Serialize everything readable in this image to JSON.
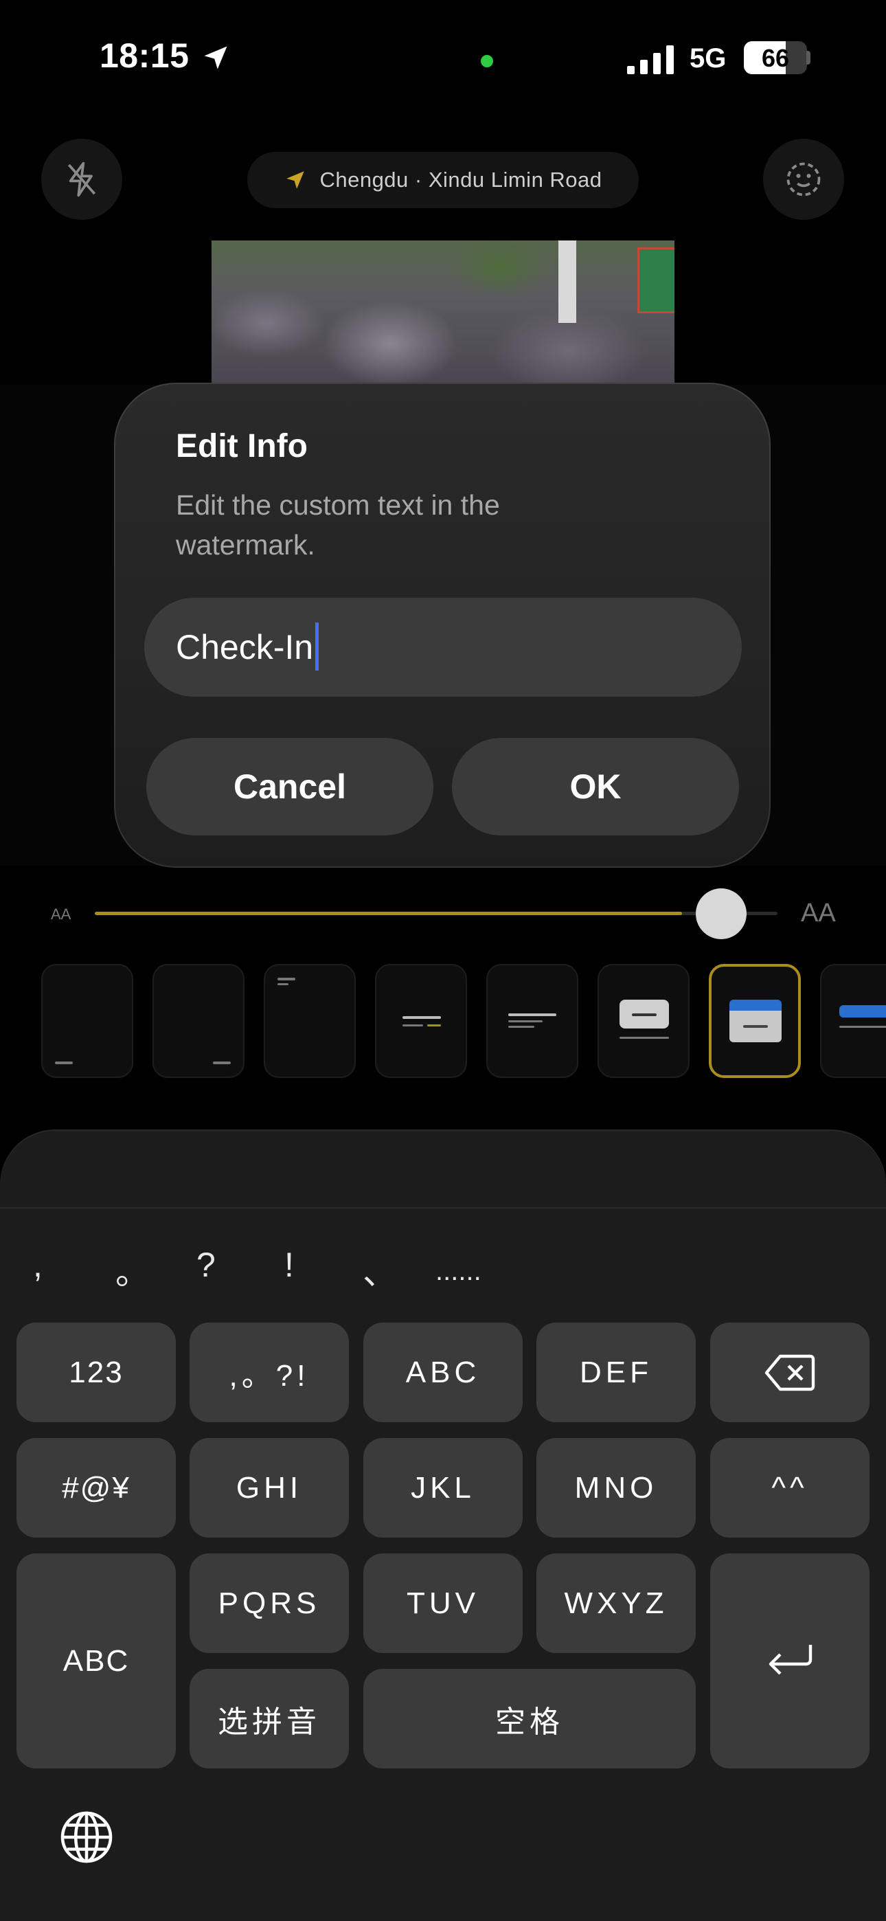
{
  "status_bar": {
    "time": "18:15",
    "network": "5G",
    "battery_percent": "66",
    "battery_level": 0.66
  },
  "camera": {
    "location_label": "Chengdu · Xindu Limin Road"
  },
  "dialog": {
    "title": "Edit Info",
    "subtitle": "Edit the custom text in the watermark.",
    "input_value": "Check-In",
    "cancel_label": "Cancel",
    "ok_label": "OK"
  },
  "text_size_slider": {
    "min_label": "AA",
    "max_label": "AA",
    "level": 0.86,
    "accent_color": "#a98d1f"
  },
  "templates": {
    "count": 8,
    "selected_index": 6
  },
  "keyboard": {
    "punctuation": [
      ",",
      "。",
      "?",
      "!",
      "、",
      "......"
    ],
    "keys": {
      "k123": "123",
      "punct_key": ",。?!",
      "abc": "ABC",
      "def": "DEF",
      "symbols": "#@¥",
      "ghi": "GHI",
      "jkl": "JKL",
      "mno": "MNO",
      "emoticon": "^^",
      "abc_mode": "ABC",
      "pqrs": "PQRS",
      "tuv": "TUV",
      "wxyz": "WXYZ",
      "pinyin": "选拼音",
      "space": "空格"
    }
  }
}
